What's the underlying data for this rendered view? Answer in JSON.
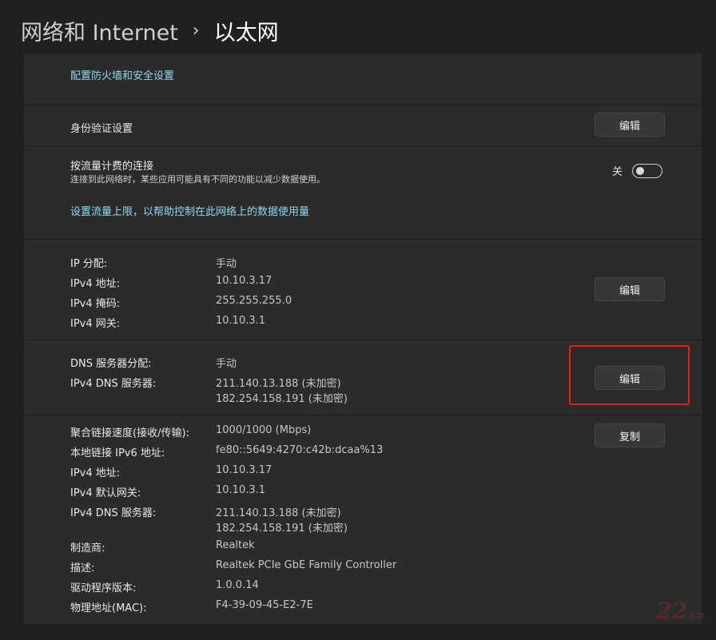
{
  "breadcrumb": {
    "parent": "网络和 Internet",
    "separator": "›",
    "current": "以太网"
  },
  "firewall_link": "配置防火墙和安全设置",
  "auth": {
    "label": "身份验证设置",
    "button": "编辑"
  },
  "metered": {
    "title": "按流量计费的连接",
    "description": "连接到此网络时，某些应用可能具有不同的功能以减少数据使用。",
    "toggle_state": "关",
    "toggle_on": false,
    "link": "设置流量上限，以帮助控制在此网络上的数据使用量"
  },
  "ip": {
    "rows": [
      {
        "label": "IP 分配:",
        "value": "手动"
      },
      {
        "label": "IPv4 地址:",
        "value": "10.10.3.17"
      },
      {
        "label": "IPv4 掩码:",
        "value": "255.255.255.0"
      },
      {
        "label": "IPv4 网关:",
        "value": "10.10.3.1"
      }
    ],
    "button": "编辑"
  },
  "dns": {
    "assign_label": "DNS 服务器分配:",
    "assign_value": "手动",
    "server_label": "IPv4 DNS 服务器:",
    "server_value_1": "211.140.13.188 (未加密)",
    "server_value_2": "182.254.158.191 (未加密)",
    "button": "编辑"
  },
  "properties": {
    "speed_label": "聚合链接速度(接收/传输):",
    "speed_value": "1000/1000 (Mbps)",
    "ipv6_label": "本地链接 IPv6 地址:",
    "ipv6_value": "fe80::5649:4270:c42b:dcaa%13",
    "ipv4_label": "IPv4 地址:",
    "ipv4_value": "10.10.3.17",
    "gateway_label": "IPv4 默认网关:",
    "gateway_value": "10.10.3.1",
    "dns_label": "IPv4 DNS 服务器:",
    "dns_value_1": "211.140.13.188 (未加密)",
    "dns_value_2": "182.254.158.191 (未加密)",
    "manufacturer_label": "制造商:",
    "manufacturer_value": "Realtek",
    "description_label": "描述:",
    "description_value": "Realtek PCIe GbE Family Controller",
    "driver_label": "驱动程序版本:",
    "driver_value": "1.0.0.14",
    "mac_label": "物理地址(MAC):",
    "mac_value": "F4-39-09-45-E2-7E",
    "button": "复制"
  },
  "watermark": {
    "big": "22",
    "small": ".cn"
  },
  "colors": {
    "accent_link": "#8fd8f0",
    "highlight": "#e02020",
    "background": "#202020",
    "panel": "#2b2b2b"
  }
}
